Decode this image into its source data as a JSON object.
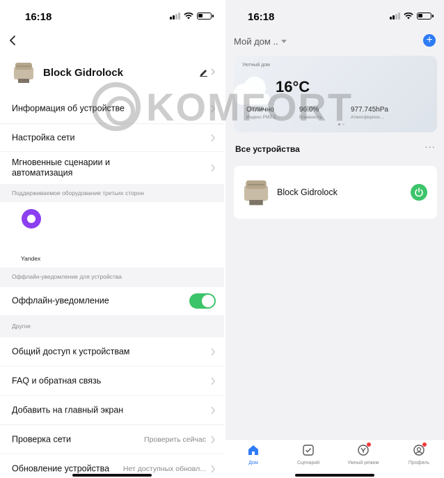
{
  "left": {
    "status": {
      "time": "16:18"
    },
    "device": {
      "name": "Block Gidrolock"
    },
    "rows_top": [
      {
        "label": "Информация об устройстве"
      },
      {
        "label": "Настройка сети"
      },
      {
        "label": "Мгновенные сценарии и автоматизация"
      }
    ],
    "section_third_party": "Поддерживаемое оборудование третьих сторон",
    "yandex_label": "Yandex",
    "section_offline": "Оффлайн-уведомление для устройства",
    "offline_row": {
      "label": "Оффлайн-уведомление",
      "toggle_on": true
    },
    "section_other": "Другое",
    "rows_other": [
      {
        "label": "Общий доступ к устройствам",
        "value": ""
      },
      {
        "label": "FAQ и обратная связь",
        "value": ""
      },
      {
        "label": "Добавить на главный экран",
        "value": ""
      },
      {
        "label": "Проверка сети",
        "value": "Проверить сейчас"
      },
      {
        "label": "Обновление устройства",
        "value": "Нет доступных обновл..."
      }
    ]
  },
  "right": {
    "status": {
      "time": "16:18"
    },
    "home_title": "Мой дом ..",
    "weather": {
      "caption": "Уютный дом",
      "temperature": "16°C",
      "stats": [
        {
          "value": "Отлично",
          "label": "Индекс PM2.5..."
        },
        {
          "value": "96.0%",
          "label": "Влажность"
        },
        {
          "value": "977.745hPa",
          "label": "Атмосферное..."
        }
      ]
    },
    "all_devices_title": "Все устройства",
    "more_label": "···",
    "device_card": {
      "name": "Block Gidrolock",
      "power_color": "#3cc46a"
    },
    "tabs": [
      {
        "label": "Дом",
        "active": true
      },
      {
        "label": "Сценарий",
        "active": false
      },
      {
        "label": "Умный режим",
        "active": false
      },
      {
        "label": "Профиль",
        "active": false
      }
    ]
  },
  "watermark": {
    "text": "KOMFORT"
  },
  "colors": {
    "accent": "#2e7bf6",
    "toggle": "#3cc46a",
    "badge": "#f03b3b",
    "yandex": "#8b3ff0"
  }
}
